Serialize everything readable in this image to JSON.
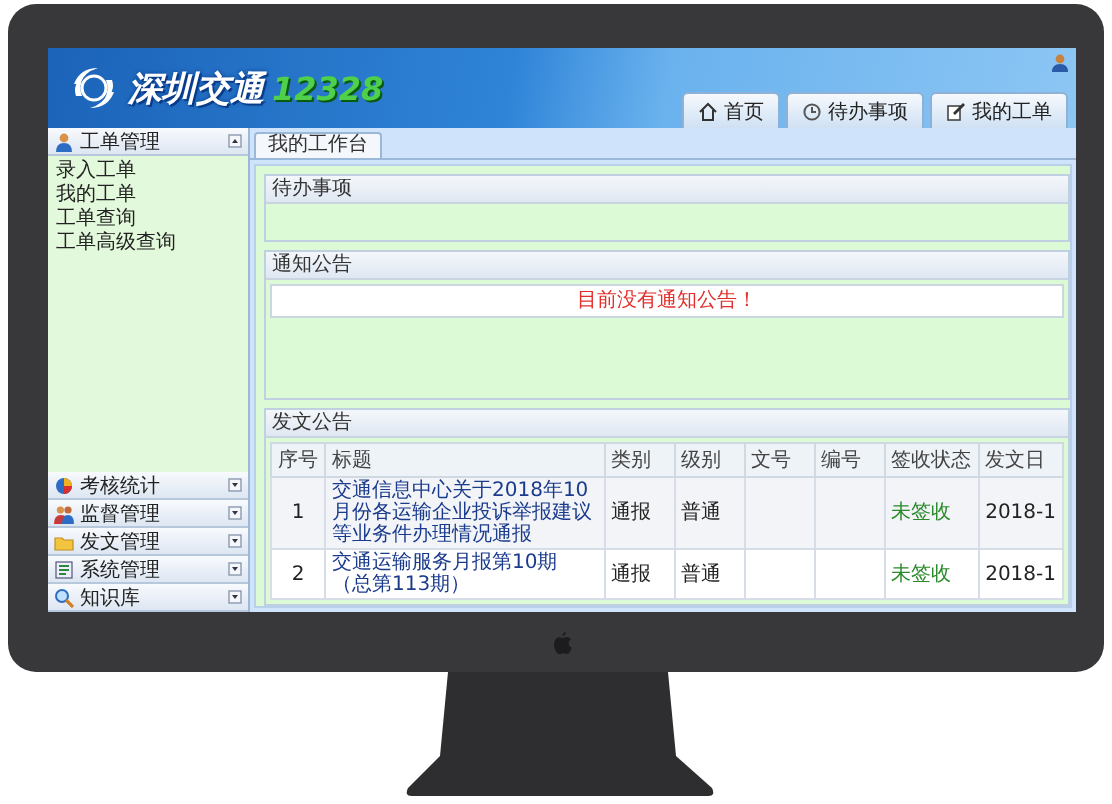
{
  "header": {
    "logo_name": "深圳交通",
    "logo_number": "12328"
  },
  "nav_tabs": [
    {
      "label": "首页"
    },
    {
      "label": "待办事项"
    },
    {
      "label": "我的工单"
    }
  ],
  "sidebar": [
    {
      "title": "工单管理",
      "expanded": true,
      "items": [
        "录入工单",
        "我的工单",
        "工单查询",
        "工单高级查询"
      ]
    },
    {
      "title": "考核统计",
      "expanded": false
    },
    {
      "title": "监督管理",
      "expanded": false
    },
    {
      "title": "发文管理",
      "expanded": false
    },
    {
      "title": "系统管理",
      "expanded": false
    },
    {
      "title": "知识库",
      "expanded": false
    }
  ],
  "content_tabs": [
    {
      "label": "我的工作台",
      "selected": true
    }
  ],
  "pending": {
    "title": "待办事项"
  },
  "notices": {
    "title": "通知公告",
    "message": "目前没有通知公告！"
  },
  "dispatch": {
    "title": "发文公告",
    "columns": [
      {
        "label": "序号",
        "kind": "index"
      },
      {
        "label": "标题",
        "kind": "link"
      },
      {
        "label": "类别",
        "kind": "text"
      },
      {
        "label": "级别",
        "kind": "text"
      },
      {
        "label": "文号",
        "kind": "text"
      },
      {
        "label": "编号",
        "kind": "text"
      },
      {
        "label": "签收状态",
        "kind": "status"
      },
      {
        "label": "发文日",
        "kind": "text"
      }
    ],
    "rows": [
      {
        "cells": [
          "1",
          "交通信息中心关于2018年10月份各运输企业投诉举报建议等业务件办理情况通报",
          "通报",
          "普通",
          null,
          null,
          "未签收",
          "2018-1"
        ]
      },
      {
        "cells": [
          "2",
          "交通运输服务月报第10期（总第113期）",
          "通报",
          "普通",
          null,
          null,
          "未签收",
          "2018-1"
        ]
      }
    ]
  }
}
